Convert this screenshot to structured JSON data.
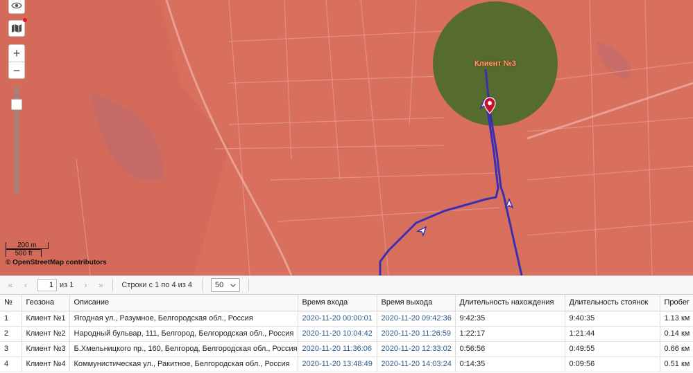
{
  "map": {
    "zone_label": "Клиент №3",
    "scale": {
      "metric": "200 m",
      "imperial": "500 ft"
    },
    "attribution": "© OpenStreetMap contributors",
    "controls": {
      "zoom_in": "+",
      "zoom_out": "−"
    },
    "colors": {
      "overlay": "#d9705e",
      "geozone": "#566b2e",
      "track": "#3a2fb0",
      "marker": "#c8102e"
    },
    "icons": [
      "eye-icon",
      "map-layers-icon",
      "location-pin-icon",
      "direction-arrow-icon"
    ]
  },
  "pager": {
    "page": "1",
    "of_label": "из 1",
    "rows_info": "Строки с 1 по 4 из 4",
    "per_page": "50",
    "first": "«",
    "prev": "‹",
    "next": "›",
    "last": "»"
  },
  "table": {
    "headers": [
      "№",
      "Геозона",
      "Описание",
      "Время входа",
      "Время выхода",
      "Длительность нахождения",
      "Длительность стоянок",
      "Пробег"
    ],
    "rows": [
      [
        "1",
        "Клиент №1",
        "Ягодная ул., Разумное, Белгородская обл., Россия",
        "2020-11-20 00:00:01",
        "2020-11-20 09:42:36",
        "9:42:35",
        "9:40:35",
        "1.13 км"
      ],
      [
        "2",
        "Клиент №2",
        "Народный бульвар, 111, Белгород, Белгородская обл., Россия",
        "2020-11-20 10:04:42",
        "2020-11-20 11:26:59",
        "1:22:17",
        "1:21:44",
        "0.14 км"
      ],
      [
        "3",
        "Клиент №3",
        "Б.Хмельницкого пр., 160, Белгород, Белгородская обл., Россия",
        "2020-11-20 11:36:06",
        "2020-11-20 12:33:02",
        "0:56:56",
        "0:49:55",
        "0.66 км"
      ],
      [
        "4",
        "Клиент №4",
        "Коммунистическая ул., Ракитное, Белгородская обл., Россия",
        "2020-11-20 13:48:49",
        "2020-11-20 14:03:24",
        "0:14:35",
        "0:09:56",
        "0.51 км"
      ]
    ]
  }
}
